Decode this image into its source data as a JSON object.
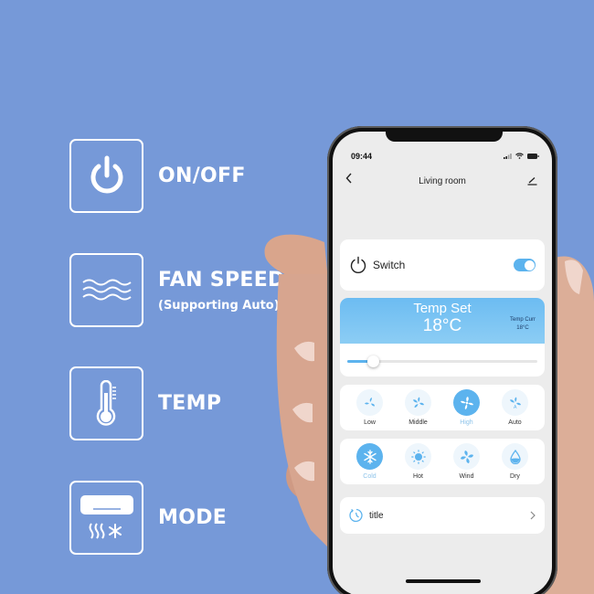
{
  "features": [
    {
      "icon": "power-icon",
      "label": "ON/OFF"
    },
    {
      "icon": "waves-icon",
      "label": "FAN SPEED",
      "sublabel": "(Supporting Auto)"
    },
    {
      "icon": "thermometer-icon",
      "label": "TEMP"
    },
    {
      "icon": "air-conditioner-icon",
      "label": "MODE"
    }
  ],
  "phone": {
    "status_time": "09:44",
    "nav_title": "Living room",
    "switch": {
      "label": "Switch",
      "on": true
    },
    "temp": {
      "set_label": "Temp Set",
      "set_value": "18°C",
      "current_label": "Temp Curr",
      "current_value": "18°C",
      "slider_fraction": 0.05
    },
    "fan_speeds": [
      {
        "label": "Low",
        "active": false
      },
      {
        "label": "Middle",
        "active": false
      },
      {
        "label": "High",
        "active": true
      },
      {
        "label": "Auto",
        "active": false
      }
    ],
    "modes": [
      {
        "label": "Cold",
        "icon": "snowflake-icon",
        "active": true
      },
      {
        "label": "Hot",
        "icon": "sun-icon",
        "active": false
      },
      {
        "label": "Wind",
        "icon": "fan-icon",
        "active": false
      },
      {
        "label": "Dry",
        "icon": "droplet-icon",
        "active": false
      }
    ],
    "timer": {
      "label": "title"
    }
  },
  "colors": {
    "background": "#7699d8",
    "accent": "#5cb3ee"
  }
}
